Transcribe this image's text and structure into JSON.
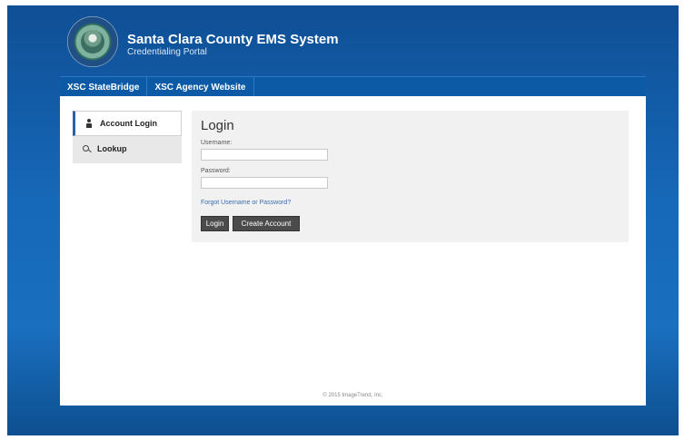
{
  "header": {
    "title": "Santa Clara County EMS System",
    "subtitle": "Credentialing Portal",
    "seal_icon": "county-seal-icon"
  },
  "nav": {
    "items": [
      {
        "label": "XSC StateBridge"
      },
      {
        "label": "XSC Agency Website"
      }
    ]
  },
  "sidebar": {
    "items": [
      {
        "label": "Account Login",
        "icon": "person-icon",
        "active": true
      },
      {
        "label": "Lookup",
        "icon": "search-icon",
        "active": false
      }
    ]
  },
  "login": {
    "heading": "Login",
    "username_label": "Username:",
    "username_value": "",
    "password_label": "Password:",
    "password_value": "",
    "forgot_link": "Forgot Username or Password?",
    "login_button": "Login",
    "create_account_button": "Create Account"
  },
  "footer": {
    "copyright": "© 2015 ImageTrend, Inc."
  },
  "colors": {
    "brand_blue": "#1668b8",
    "nav_blue": "#0c5aa6",
    "active_accent": "#2a61a9",
    "button_dark": "#4b4b4b"
  }
}
